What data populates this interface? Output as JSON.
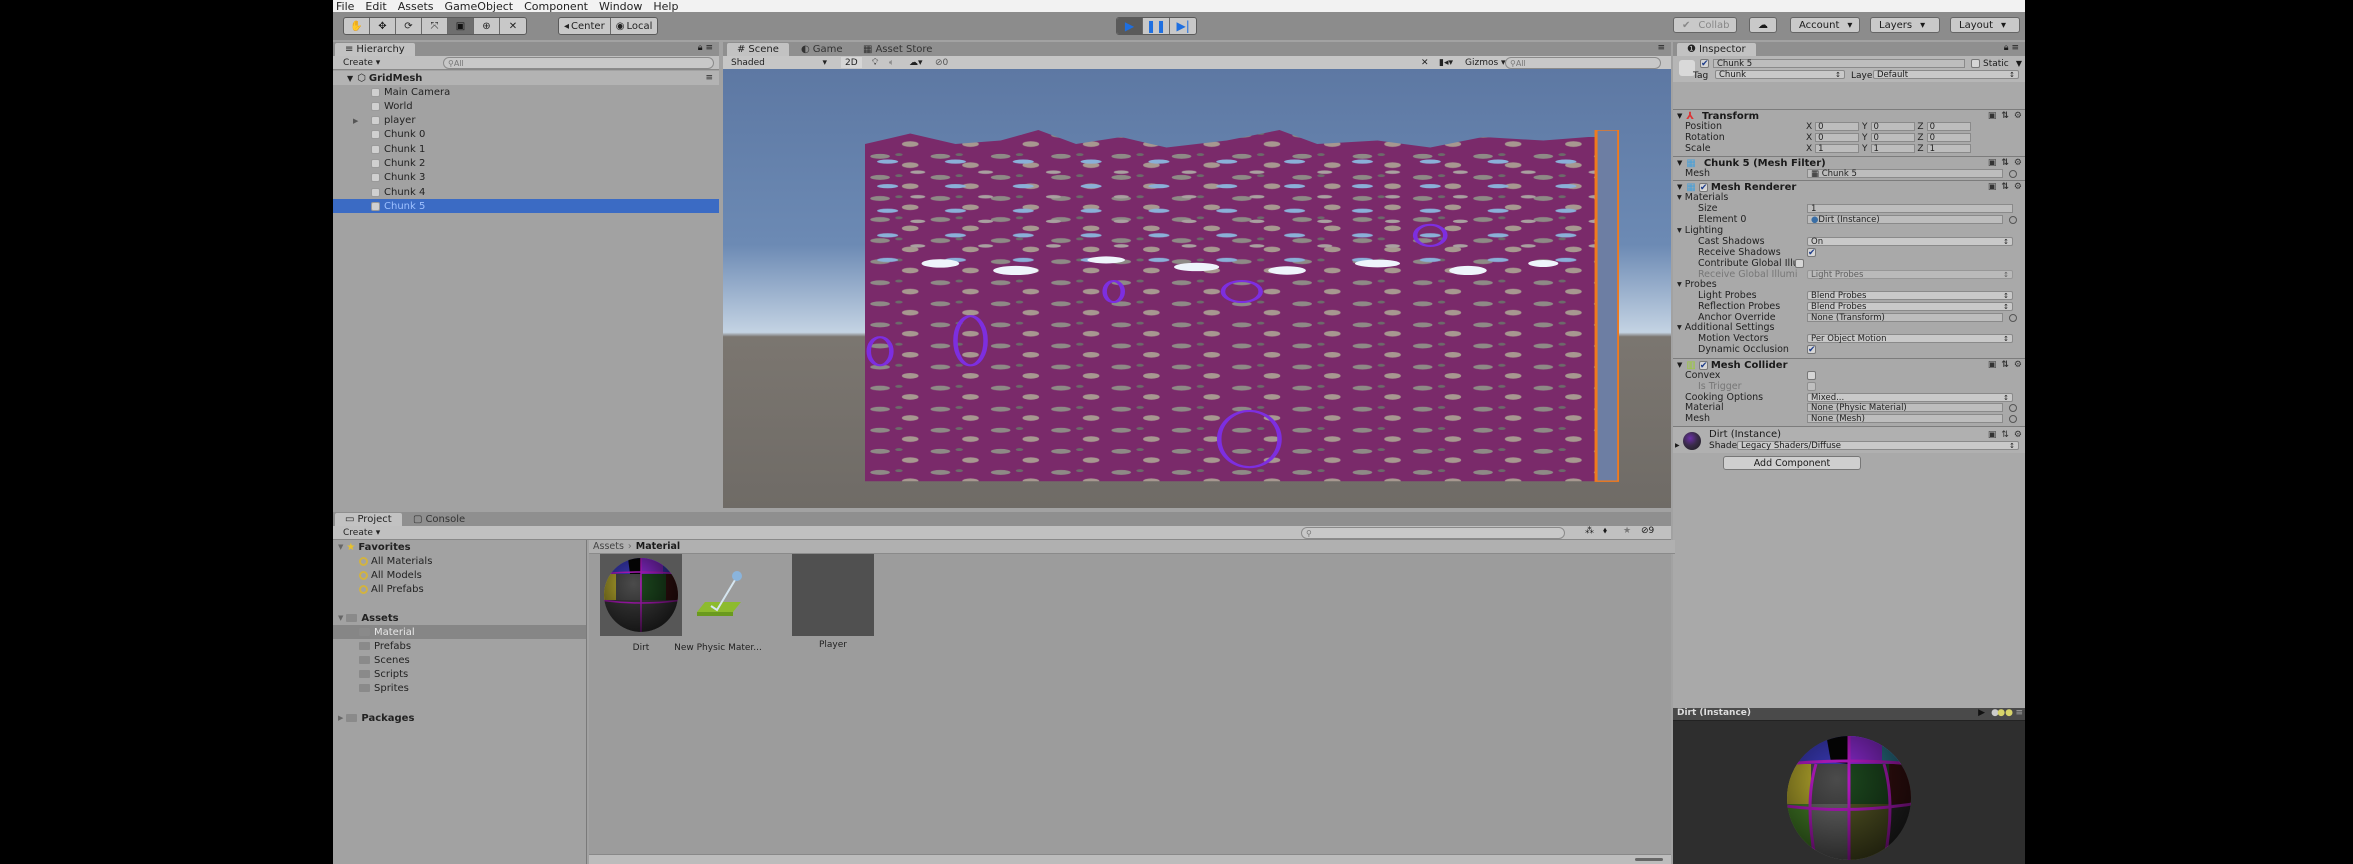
{
  "menu": [
    "File",
    "Edit",
    "Assets",
    "GameObject",
    "Component",
    "Window",
    "Help"
  ],
  "toolbar": {
    "transform_tools": [
      "hand-tool",
      "move-tool",
      "rotate-tool",
      "scale-tool",
      "rect-tool",
      "transform-tool",
      "custom-tool"
    ],
    "pivot": "Center",
    "space": "Local",
    "play_controls": [
      "play",
      "pause",
      "step"
    ],
    "collab": "Collab",
    "account": "Account",
    "layers": "Layers",
    "layout": "Layout"
  },
  "hierarchy": {
    "tab": "Hierarchy",
    "create": "Create",
    "search_placeholder": "All",
    "scene": "GridMesh",
    "items": [
      {
        "label": "Main Camera",
        "expandable": false,
        "selected": false
      },
      {
        "label": "World",
        "expandable": false,
        "selected": false
      },
      {
        "label": "player",
        "expandable": true,
        "selected": false
      },
      {
        "label": "Chunk 0",
        "expandable": false,
        "selected": false
      },
      {
        "label": "Chunk 1",
        "expandable": false,
        "selected": false
      },
      {
        "label": "Chunk 2",
        "expandable": false,
        "selected": false
      },
      {
        "label": "Chunk 3",
        "expandable": false,
        "selected": false
      },
      {
        "label": "Chunk 4",
        "expandable": false,
        "selected": false
      },
      {
        "label": "Chunk 5",
        "expandable": false,
        "selected": true
      }
    ]
  },
  "scene": {
    "tabs": [
      "Scene",
      "Game",
      "Asset Store"
    ],
    "active_tab": "Scene",
    "shading": "Shaded",
    "mode_2d": "2D",
    "hidden_count": "0",
    "gizmos": "Gizmos",
    "search_placeholder": "All"
  },
  "project": {
    "tabs": [
      "Project",
      "Console"
    ],
    "create": "Create",
    "favorites_label": "Favorites",
    "favorites": [
      "All Materials",
      "All Models",
      "All Prefabs"
    ],
    "assets_label": "Assets",
    "folders": [
      {
        "label": "Material",
        "selected": true
      },
      {
        "label": "Prefabs",
        "selected": false
      },
      {
        "label": "Scenes",
        "selected": false
      },
      {
        "label": "Scripts",
        "selected": false
      },
      {
        "label": "Sprites",
        "selected": false
      }
    ],
    "packages_label": "Packages",
    "breadcrumb": [
      "Assets",
      "Material"
    ],
    "hidden_count": "9",
    "assets": [
      {
        "name": "Dirt",
        "type": "material"
      },
      {
        "name": "New Physic Mater...",
        "type": "physic-material"
      },
      {
        "name": "Player",
        "type": "material"
      }
    ]
  },
  "inspector": {
    "tab": "Inspector",
    "object_name": "Chunk 5",
    "active": true,
    "static_label": "Static",
    "tag_label": "Tag",
    "tag": "Chunk",
    "layer_label": "Layer",
    "layer": "Default",
    "transform": {
      "title": "Transform",
      "position": {
        "label": "Position",
        "x": "0",
        "y": "0",
        "z": "0"
      },
      "rotation": {
        "label": "Rotation",
        "x": "0",
        "y": "0",
        "z": "0"
      },
      "scale": {
        "label": "Scale",
        "x": "1",
        "y": "1",
        "z": "1"
      }
    },
    "mesh_filter": {
      "title": "Chunk 5 (Mesh Filter)",
      "mesh_label": "Mesh",
      "mesh": "Chunk 5"
    },
    "mesh_renderer": {
      "title": "Mesh Renderer",
      "enabled": true,
      "materials": "Materials",
      "size_label": "Size",
      "size": "1",
      "element0_label": "Element 0",
      "element0": "Dirt (Instance)",
      "lighting": "Lighting",
      "cast_shadows_label": "Cast Shadows",
      "cast_shadows": "On",
      "receive_shadows_label": "Receive Shadows",
      "receive_shadows": true,
      "contribute_gi_label": "Contribute Global Illu",
      "contribute_gi": false,
      "receive_gi_label": "Receive Global Illumi",
      "receive_gi": "Light Probes",
      "probes": "Probes",
      "light_probes_label": "Light Probes",
      "light_probes": "Blend Probes",
      "reflection_probes_label": "Reflection Probes",
      "reflection_probes": "Blend Probes",
      "anchor_override_label": "Anchor Override",
      "anchor_override": "None (Transform)",
      "additional": "Additional Settings",
      "motion_vectors_label": "Motion Vectors",
      "motion_vectors": "Per Object Motion",
      "dynamic_occlusion_label": "Dynamic Occlusion",
      "dynamic_occlusion": true
    },
    "mesh_collider": {
      "title": "Mesh Collider",
      "enabled": true,
      "convex_label": "Convex",
      "convex": false,
      "is_trigger_label": "Is Trigger",
      "is_trigger": false,
      "cooking_label": "Cooking Options",
      "cooking": "Mixed...",
      "material_label": "Material",
      "material": "None (Physic Material)",
      "mesh_label": "Mesh",
      "mesh": "None (Mesh)"
    },
    "material": {
      "name": "Dirt (Instance)",
      "shader_label": "Shader",
      "shader": "Legacy Shaders/Diffuse"
    },
    "add_component": "Add Component",
    "preview_title": "Dirt (Instance)"
  },
  "colors": {
    "selection": "#3b6bc4",
    "panel": "#a2a2a2",
    "terrain": "#7a2a6a",
    "selection_outline": "#f07a1e"
  }
}
